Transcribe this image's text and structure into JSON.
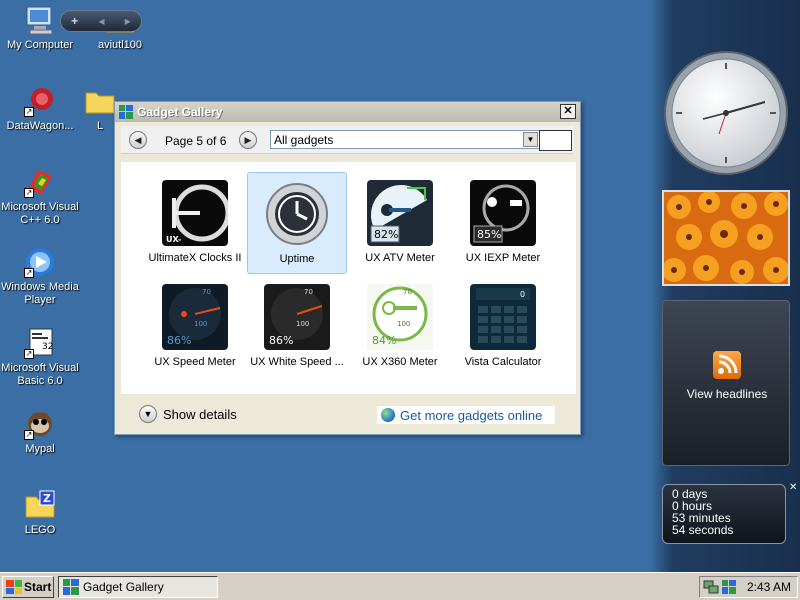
{
  "desktop": {
    "icons": [
      {
        "label": "My Computer",
        "icon": "computer-icon"
      },
      {
        "label": "aviutl100",
        "icon": "folder-icon"
      },
      {
        "label": "DataWagon...",
        "icon": "datawagon-icon"
      },
      {
        "label": "L",
        "icon": "folder-icon"
      },
      {
        "label": "Microsoft Visual C++ 6.0",
        "icon": "visual-cpp-icon"
      },
      {
        "label": "Windows Media Player",
        "icon": "media-player-icon"
      },
      {
        "label": "Microsoft Visual Basic 6.0",
        "icon": "visual-basic-icon"
      },
      {
        "label": "Mypal",
        "icon": "mypal-icon"
      },
      {
        "label": "LEGO",
        "icon": "zip-folder-icon"
      }
    ]
  },
  "sidebar": {
    "controls": {
      "add": "+",
      "prev": "◂",
      "next": "▸"
    },
    "feed_label": "View headlines",
    "uptime": {
      "days": "0 days",
      "hours": "0 hours",
      "minutes": "53 minutes",
      "seconds": "54 seconds"
    }
  },
  "gallery": {
    "title": "Gadget Gallery",
    "close": "✕",
    "page_label": "Page 5 of 6",
    "filter_value": "All gadgets",
    "prev_icon": "◀",
    "next_icon": "▶",
    "tiles": [
      {
        "name": "UltimateX Clocks II",
        "icon": "ultimatex-clocks-icon",
        "selected": false
      },
      {
        "name": "Uptime",
        "icon": "uptime-clock-icon",
        "selected": true
      },
      {
        "name": "UX ATV Meter",
        "icon": "atv-meter-icon",
        "selected": false,
        "percent": "82%"
      },
      {
        "name": "UX IEXP Meter",
        "icon": "iexp-meter-icon",
        "selected": false,
        "percent": "85%"
      },
      {
        "name": "UX Speed Meter",
        "icon": "speed-meter-icon",
        "selected": false,
        "percent": "86%"
      },
      {
        "name": "UX White Speed ...",
        "icon": "white-speed-meter-icon",
        "selected": false,
        "percent": "86%"
      },
      {
        "name": "UX X360 Meter",
        "icon": "x360-meter-icon",
        "selected": false,
        "percent": "84%"
      },
      {
        "name": "Vista Calculator",
        "icon": "calculator-icon",
        "selected": false
      }
    ],
    "show_details": "Show details",
    "more_online": "Get more gadgets online"
  },
  "taskbar": {
    "start_label": "Start",
    "task_label": "Gadget Gallery",
    "clock": "2:43 AM"
  }
}
